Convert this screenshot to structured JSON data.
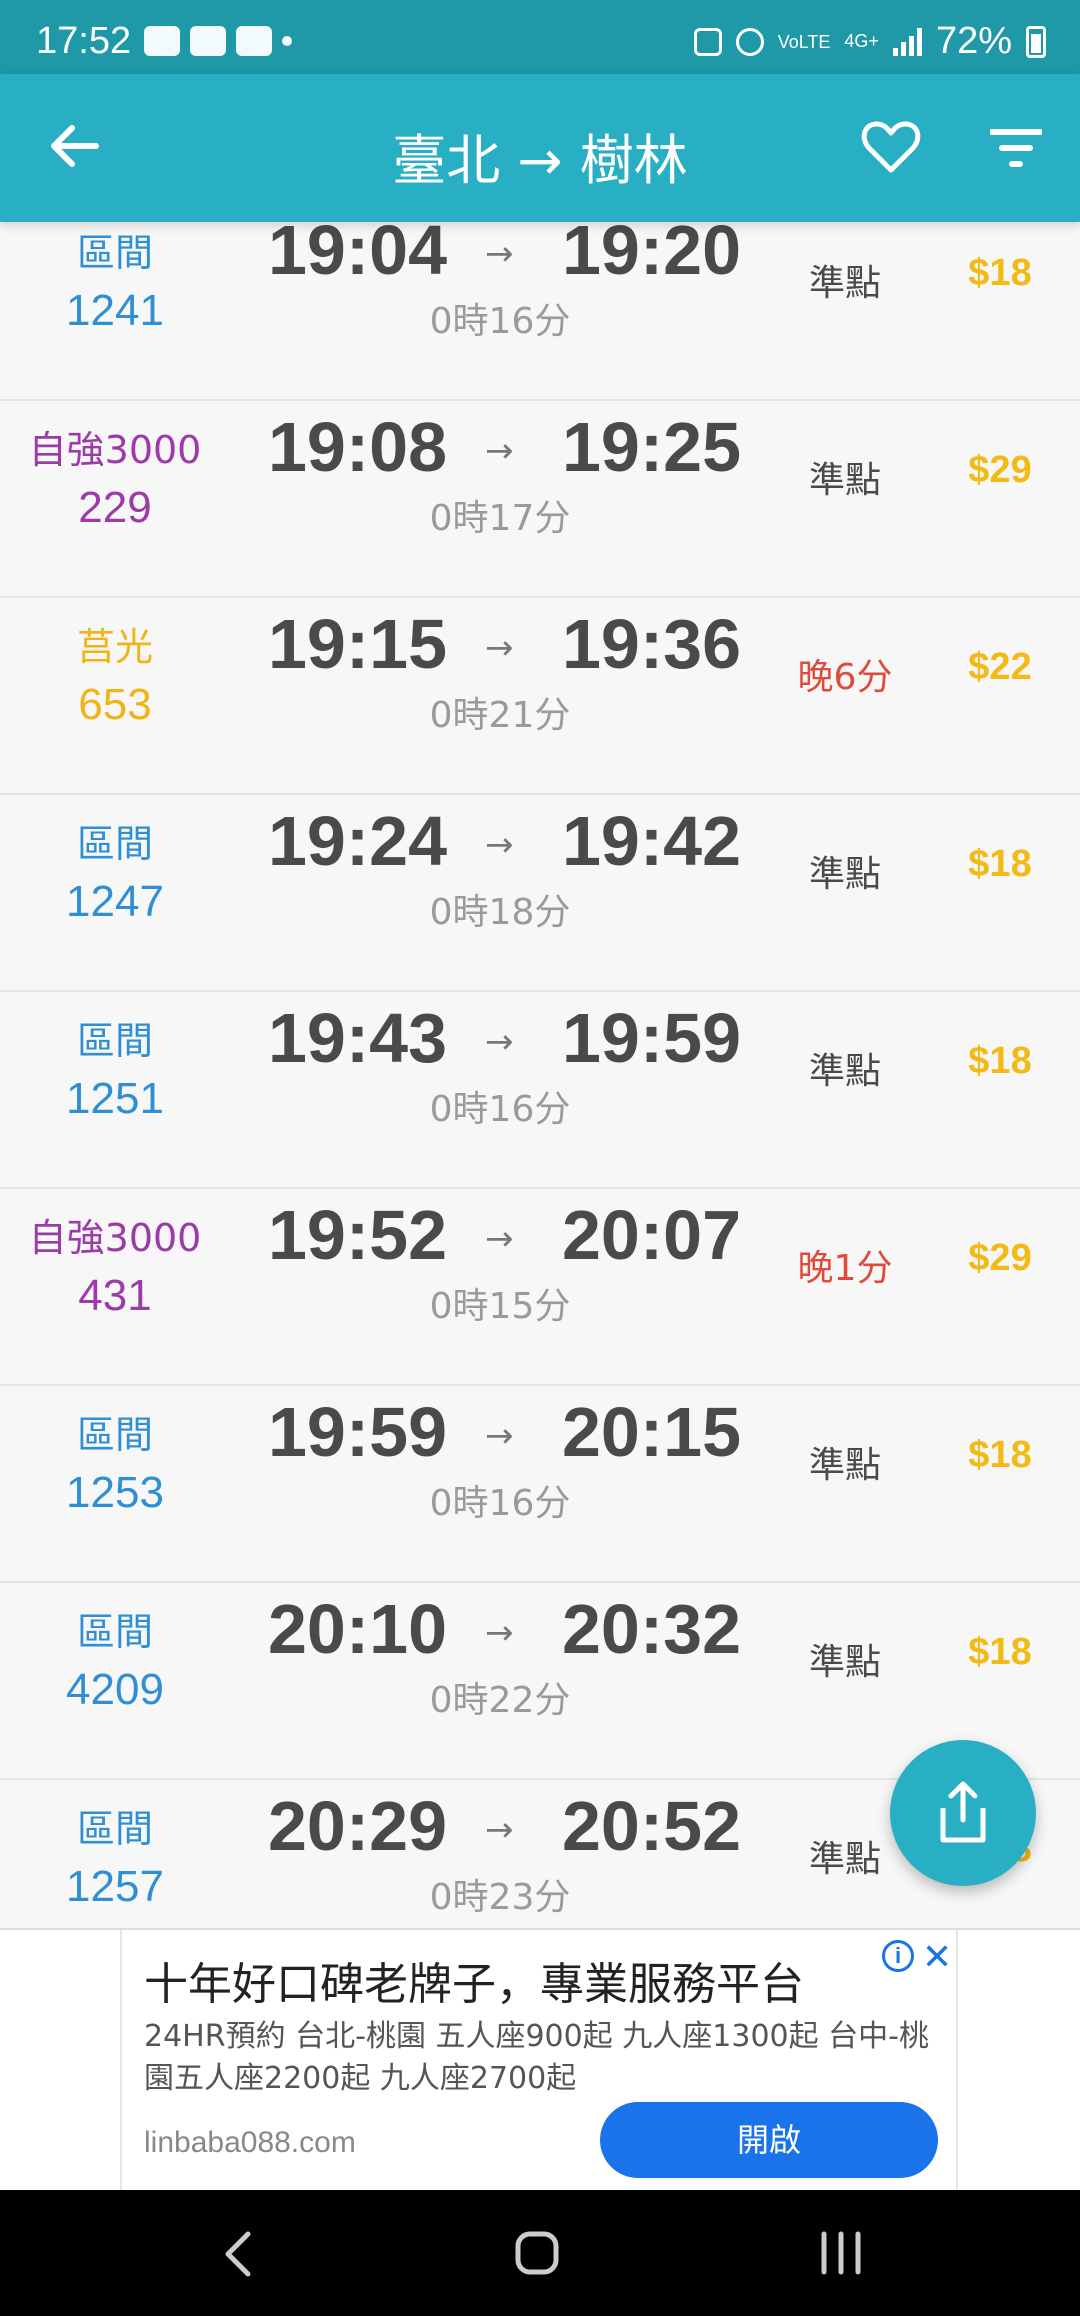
{
  "status_bar": {
    "time": "17:52",
    "battery": "72%",
    "network": "4G+",
    "volte": "VoLTE"
  },
  "header": {
    "title": "臺北 → 樹林",
    "background_color": "#29afc4"
  },
  "colors": {
    "local": "#2f8fd2",
    "tze_chiang": "#9b3aa8",
    "chu_kuang": "#f0b419",
    "on_time": "#4a4a4a",
    "delayed": "#e04a3c",
    "price": "#f3b914"
  },
  "trains": [
    {
      "type": "區間",
      "number": "1241",
      "depart": "19:04",
      "arrive": "19:20",
      "duration": "0時16分",
      "status": "準點",
      "price": "$18",
      "kind": "local",
      "delayed": false
    },
    {
      "type": "自強3000",
      "number": "229",
      "depart": "19:08",
      "arrive": "19:25",
      "duration": "0時17分",
      "status": "準點",
      "price": "$29",
      "kind": "tze_chiang",
      "delayed": false
    },
    {
      "type": "莒光",
      "number": "653",
      "depart": "19:15",
      "arrive": "19:36",
      "duration": "0時21分",
      "status": "晚6分",
      "price": "$22",
      "kind": "chu_kuang",
      "delayed": true
    },
    {
      "type": "區間",
      "number": "1247",
      "depart": "19:24",
      "arrive": "19:42",
      "duration": "0時18分",
      "status": "準點",
      "price": "$18",
      "kind": "local",
      "delayed": false
    },
    {
      "type": "區間",
      "number": "1251",
      "depart": "19:43",
      "arrive": "19:59",
      "duration": "0時16分",
      "status": "準點",
      "price": "$18",
      "kind": "local",
      "delayed": false
    },
    {
      "type": "自強3000",
      "number": "431",
      "depart": "19:52",
      "arrive": "20:07",
      "duration": "0時15分",
      "status": "晚1分",
      "price": "$29",
      "kind": "tze_chiang",
      "delayed": true
    },
    {
      "type": "區間",
      "number": "1253",
      "depart": "19:59",
      "arrive": "20:15",
      "duration": "0時16分",
      "status": "準點",
      "price": "$18",
      "kind": "local",
      "delayed": false
    },
    {
      "type": "區間",
      "number": "4209",
      "depart": "20:10",
      "arrive": "20:32",
      "duration": "0時22分",
      "status": "準點",
      "price": "$18",
      "kind": "local",
      "delayed": false
    },
    {
      "type": "區間",
      "number": "1257",
      "depart": "20:29",
      "arrive": "20:52",
      "duration": "0時23分",
      "status": "準點",
      "price": "$18",
      "kind": "local",
      "delayed": false
    }
  ],
  "arrow_symbol": "→",
  "fab": {
    "icon": "share-icon"
  },
  "ad": {
    "title": "十年好口碑老牌子，專業服務平台",
    "body": "24HR預約 台北-桃園 五人座900起 九人座1300起 台中-桃園五人座2200起 九人座2700起",
    "url": "linbaba088.com",
    "button": "開啟",
    "info_symbol": "i",
    "close_symbol": "✕"
  },
  "nav": {
    "icons": [
      "back-icon",
      "home-icon",
      "recents-icon"
    ]
  }
}
